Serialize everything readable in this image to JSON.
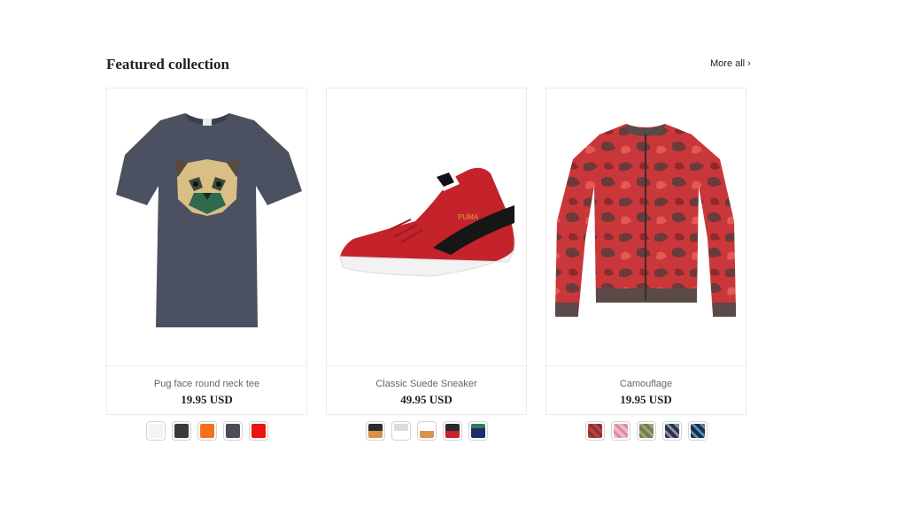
{
  "section": {
    "title": "Featured collection",
    "more_label": "More all ›"
  },
  "products": [
    {
      "name": "Pug face round neck tee",
      "price": "19.95 USD",
      "image_icon": "pug-tshirt-image",
      "swatches": [
        "#f4f4f4",
        "#3a3a3a",
        "#f4721e",
        "#4a4c59",
        "#e8170f"
      ]
    },
    {
      "name": "Classic Suede Sneaker",
      "price": "49.95 USD",
      "image_icon": "red-sneaker-image",
      "swatches": [
        [
          "#2c2c2c",
          "#d9904a"
        ],
        [
          "#d8dde0",
          "#ffffff"
        ],
        [
          "#ffffff",
          "#d6954c"
        ],
        [
          "#2a2a2a",
          "#c8202e"
        ],
        [
          "#2f7a5a",
          "#1e2a6a"
        ]
      ]
    },
    {
      "name": "Camouflage",
      "price": "19.95 USD",
      "image_icon": "camo-jacket-image",
      "swatches": [
        [
          "#c9373a",
          "#6b3b3b"
        ],
        [
          "#f0b8c4",
          "#d98a9c"
        ],
        [
          "#6f7f52",
          "#a4a47a"
        ],
        [
          "#2d3446",
          "#8c96ac"
        ],
        [
          "#1f2a40",
          "#4e8fc8"
        ]
      ]
    }
  ]
}
